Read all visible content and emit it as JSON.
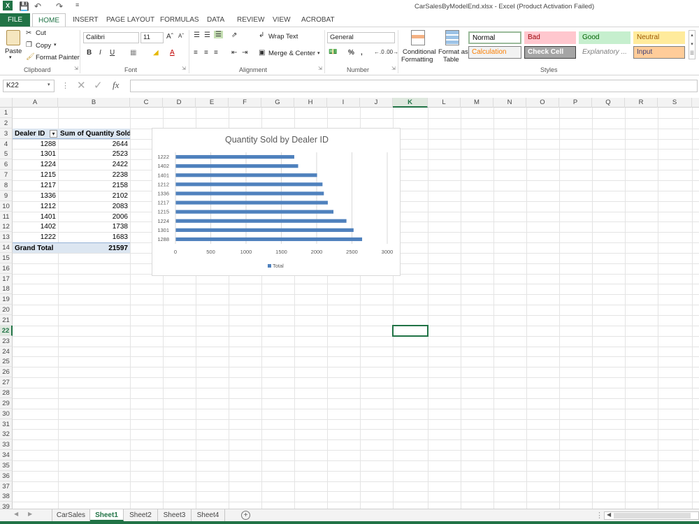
{
  "window": {
    "title": "CarSalesByModelEnd.xlsx - Excel (Product Activation Failed)"
  },
  "tabs": [
    "FILE",
    "HOME",
    "INSERT",
    "PAGE LAYOUT",
    "FORMULAS",
    "DATA",
    "REVIEW",
    "VIEW",
    "ACROBAT"
  ],
  "ribbon": {
    "clipboard": {
      "paste": "Paste",
      "cut": "Cut",
      "copy": "Copy",
      "format_painter": "Format Painter",
      "label": "Clipboard"
    },
    "font": {
      "name": "Calibri",
      "size": "11",
      "label": "Font",
      "bold": "B",
      "italic": "I",
      "underline": "U"
    },
    "alignment": {
      "wrap_text": "Wrap Text",
      "merge_center": "Merge & Center",
      "label": "Alignment"
    },
    "number": {
      "format": "General",
      "percent": "%",
      "comma": ",",
      "label": "Number"
    },
    "styles": {
      "conditional_formatting": [
        "Conditional",
        "Formatting"
      ],
      "format_as_table": [
        "Format as",
        "Table"
      ],
      "label": "Styles",
      "cells": [
        {
          "name": "Normal",
          "bg": "#ffffff",
          "fg": "#000000",
          "border": "#9bbb9b"
        },
        {
          "name": "Bad",
          "bg": "#ffc7ce",
          "fg": "#9c0006",
          "border": "#ffc7ce"
        },
        {
          "name": "Good",
          "bg": "#c6efce",
          "fg": "#006100",
          "border": "#c6efce"
        },
        {
          "name": "Neutral",
          "bg": "#ffeb9c",
          "fg": "#9c5700",
          "border": "#ffeb9c"
        },
        {
          "name": "Calculation",
          "bg": "#f2f2f2",
          "fg": "#fa7d00",
          "border": "#7f7f7f"
        },
        {
          "name": "Check Cell",
          "bg": "#a5a5a5",
          "fg": "#ffffff",
          "border": "#3f3f3f"
        },
        {
          "name": "Explanatory ...",
          "bg": "#ffffff",
          "fg": "#7f7f7f",
          "border": "#ffffff"
        },
        {
          "name": "Input",
          "bg": "#ffcc99",
          "fg": "#3f3f76",
          "border": "#7f7f7f"
        }
      ]
    }
  },
  "formula_bar": {
    "name_box": "K22",
    "fx": "fx",
    "value": ""
  },
  "columns": [
    "A",
    "B",
    "C",
    "D",
    "E",
    "F",
    "G",
    "H",
    "I",
    "J",
    "K",
    "L",
    "M",
    "N",
    "O",
    "P",
    "Q",
    "R",
    "S"
  ],
  "rows": [
    "1",
    "2",
    "3",
    "4",
    "5",
    "6",
    "7",
    "8",
    "9",
    "10",
    "11",
    "12",
    "13",
    "14",
    "15",
    "16",
    "17",
    "18",
    "19",
    "20",
    "21",
    "22",
    "23",
    "24",
    "25",
    "26",
    "27",
    "28",
    "29",
    "30",
    "31",
    "32",
    "33",
    "34",
    "35",
    "36",
    "37",
    "38",
    "39"
  ],
  "pivot": {
    "header_dealer": "Dealer ID",
    "header_sum": "Sum of Quantity Sold",
    "rows": [
      {
        "id": "1288",
        "qty": "2644"
      },
      {
        "id": "1301",
        "qty": "2523"
      },
      {
        "id": "1224",
        "qty": "2422"
      },
      {
        "id": "1215",
        "qty": "2238"
      },
      {
        "id": "1217",
        "qty": "2158"
      },
      {
        "id": "1336",
        "qty": "2102"
      },
      {
        "id": "1212",
        "qty": "2083"
      },
      {
        "id": "1401",
        "qty": "2006"
      },
      {
        "id": "1402",
        "qty": "1738"
      },
      {
        "id": "1222",
        "qty": "1683"
      }
    ],
    "grand_total_label": "Grand Total",
    "grand_total": "21597"
  },
  "chart_data": {
    "type": "bar",
    "orientation": "horizontal",
    "title": "Quantity Sold by Dealer ID",
    "categories": [
      "1222",
      "1402",
      "1401",
      "1212",
      "1336",
      "1217",
      "1215",
      "1224",
      "1301",
      "1288"
    ],
    "series": [
      {
        "name": "Total",
        "values": [
          1683,
          1738,
          2006,
          2083,
          2102,
          2158,
          2238,
          2422,
          2523,
          2644
        ],
        "color": "#4f81bd"
      }
    ],
    "xlim": [
      0,
      3000
    ],
    "xticks": [
      "0",
      "500",
      "1000",
      "1500",
      "2000",
      "2500",
      "3000"
    ],
    "grid": true,
    "legend": "bottom"
  },
  "sheets": {
    "tabs": [
      "CarSales",
      "Sheet1",
      "Sheet2",
      "Sheet3",
      "Sheet4"
    ],
    "active": "Sheet1",
    "add": "+"
  },
  "colors": {
    "accent": "#217346",
    "selection": "#217346"
  }
}
